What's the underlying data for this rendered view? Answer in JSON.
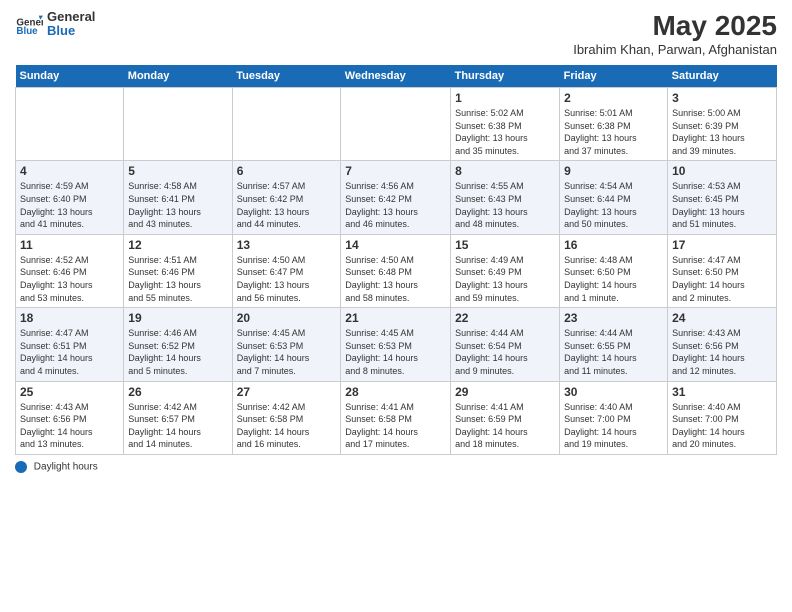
{
  "header": {
    "logo_general": "General",
    "logo_blue": "Blue",
    "main_title": "May 2025",
    "subtitle": "Ibrahim Khan, Parwan, Afghanistan"
  },
  "days_of_week": [
    "Sunday",
    "Monday",
    "Tuesday",
    "Wednesday",
    "Thursday",
    "Friday",
    "Saturday"
  ],
  "footer_label": "Daylight hours",
  "weeks": [
    [
      {
        "day": "",
        "info": ""
      },
      {
        "day": "",
        "info": ""
      },
      {
        "day": "",
        "info": ""
      },
      {
        "day": "",
        "info": ""
      },
      {
        "day": "1",
        "info": "Sunrise: 5:02 AM\nSunset: 6:38 PM\nDaylight: 13 hours\nand 35 minutes."
      },
      {
        "day": "2",
        "info": "Sunrise: 5:01 AM\nSunset: 6:38 PM\nDaylight: 13 hours\nand 37 minutes."
      },
      {
        "day": "3",
        "info": "Sunrise: 5:00 AM\nSunset: 6:39 PM\nDaylight: 13 hours\nand 39 minutes."
      }
    ],
    [
      {
        "day": "4",
        "info": "Sunrise: 4:59 AM\nSunset: 6:40 PM\nDaylight: 13 hours\nand 41 minutes."
      },
      {
        "day": "5",
        "info": "Sunrise: 4:58 AM\nSunset: 6:41 PM\nDaylight: 13 hours\nand 43 minutes."
      },
      {
        "day": "6",
        "info": "Sunrise: 4:57 AM\nSunset: 6:42 PM\nDaylight: 13 hours\nand 44 minutes."
      },
      {
        "day": "7",
        "info": "Sunrise: 4:56 AM\nSunset: 6:42 PM\nDaylight: 13 hours\nand 46 minutes."
      },
      {
        "day": "8",
        "info": "Sunrise: 4:55 AM\nSunset: 6:43 PM\nDaylight: 13 hours\nand 48 minutes."
      },
      {
        "day": "9",
        "info": "Sunrise: 4:54 AM\nSunset: 6:44 PM\nDaylight: 13 hours\nand 50 minutes."
      },
      {
        "day": "10",
        "info": "Sunrise: 4:53 AM\nSunset: 6:45 PM\nDaylight: 13 hours\nand 51 minutes."
      }
    ],
    [
      {
        "day": "11",
        "info": "Sunrise: 4:52 AM\nSunset: 6:46 PM\nDaylight: 13 hours\nand 53 minutes."
      },
      {
        "day": "12",
        "info": "Sunrise: 4:51 AM\nSunset: 6:46 PM\nDaylight: 13 hours\nand 55 minutes."
      },
      {
        "day": "13",
        "info": "Sunrise: 4:50 AM\nSunset: 6:47 PM\nDaylight: 13 hours\nand 56 minutes."
      },
      {
        "day": "14",
        "info": "Sunrise: 4:50 AM\nSunset: 6:48 PM\nDaylight: 13 hours\nand 58 minutes."
      },
      {
        "day": "15",
        "info": "Sunrise: 4:49 AM\nSunset: 6:49 PM\nDaylight: 13 hours\nand 59 minutes."
      },
      {
        "day": "16",
        "info": "Sunrise: 4:48 AM\nSunset: 6:50 PM\nDaylight: 14 hours\nand 1 minute."
      },
      {
        "day": "17",
        "info": "Sunrise: 4:47 AM\nSunset: 6:50 PM\nDaylight: 14 hours\nand 2 minutes."
      }
    ],
    [
      {
        "day": "18",
        "info": "Sunrise: 4:47 AM\nSunset: 6:51 PM\nDaylight: 14 hours\nand 4 minutes."
      },
      {
        "day": "19",
        "info": "Sunrise: 4:46 AM\nSunset: 6:52 PM\nDaylight: 14 hours\nand 5 minutes."
      },
      {
        "day": "20",
        "info": "Sunrise: 4:45 AM\nSunset: 6:53 PM\nDaylight: 14 hours\nand 7 minutes."
      },
      {
        "day": "21",
        "info": "Sunrise: 4:45 AM\nSunset: 6:53 PM\nDaylight: 14 hours\nand 8 minutes."
      },
      {
        "day": "22",
        "info": "Sunrise: 4:44 AM\nSunset: 6:54 PM\nDaylight: 14 hours\nand 9 minutes."
      },
      {
        "day": "23",
        "info": "Sunrise: 4:44 AM\nSunset: 6:55 PM\nDaylight: 14 hours\nand 11 minutes."
      },
      {
        "day": "24",
        "info": "Sunrise: 4:43 AM\nSunset: 6:56 PM\nDaylight: 14 hours\nand 12 minutes."
      }
    ],
    [
      {
        "day": "25",
        "info": "Sunrise: 4:43 AM\nSunset: 6:56 PM\nDaylight: 14 hours\nand 13 minutes."
      },
      {
        "day": "26",
        "info": "Sunrise: 4:42 AM\nSunset: 6:57 PM\nDaylight: 14 hours\nand 14 minutes."
      },
      {
        "day": "27",
        "info": "Sunrise: 4:42 AM\nSunset: 6:58 PM\nDaylight: 14 hours\nand 16 minutes."
      },
      {
        "day": "28",
        "info": "Sunrise: 4:41 AM\nSunset: 6:58 PM\nDaylight: 14 hours\nand 17 minutes."
      },
      {
        "day": "29",
        "info": "Sunrise: 4:41 AM\nSunset: 6:59 PM\nDaylight: 14 hours\nand 18 minutes."
      },
      {
        "day": "30",
        "info": "Sunrise: 4:40 AM\nSunset: 7:00 PM\nDaylight: 14 hours\nand 19 minutes."
      },
      {
        "day": "31",
        "info": "Sunrise: 4:40 AM\nSunset: 7:00 PM\nDaylight: 14 hours\nand 20 minutes."
      }
    ]
  ]
}
